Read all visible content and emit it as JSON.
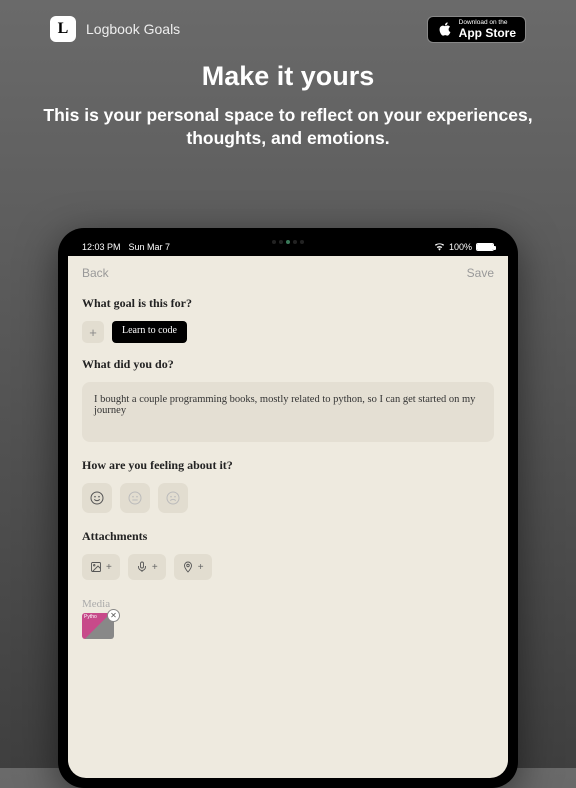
{
  "topbar": {
    "app_name": "Logbook Goals",
    "app_letter": "L",
    "appstore_small": "Download on the",
    "appstore_big": "App Store"
  },
  "hero": {
    "title": "Make it yours",
    "sub": "This is your personal space to reflect on your experiences, thoughts, and emotions."
  },
  "statusbar": {
    "time": "12:03 PM",
    "date": "Sun Mar 7",
    "battery_pct": "100%"
  },
  "navbar": {
    "back": "Back",
    "save": "Save"
  },
  "sections": {
    "goal_title": "What goal is this for?",
    "goal_tag": "Learn to code",
    "did_title": "What did you do?",
    "did_text": "I bought a couple programming books, mostly related to python, so I can get started on my journey",
    "feel_title": "How are you feeling about it?",
    "attach_title": "Attachments",
    "media_label": "Media"
  },
  "plus": "+"
}
